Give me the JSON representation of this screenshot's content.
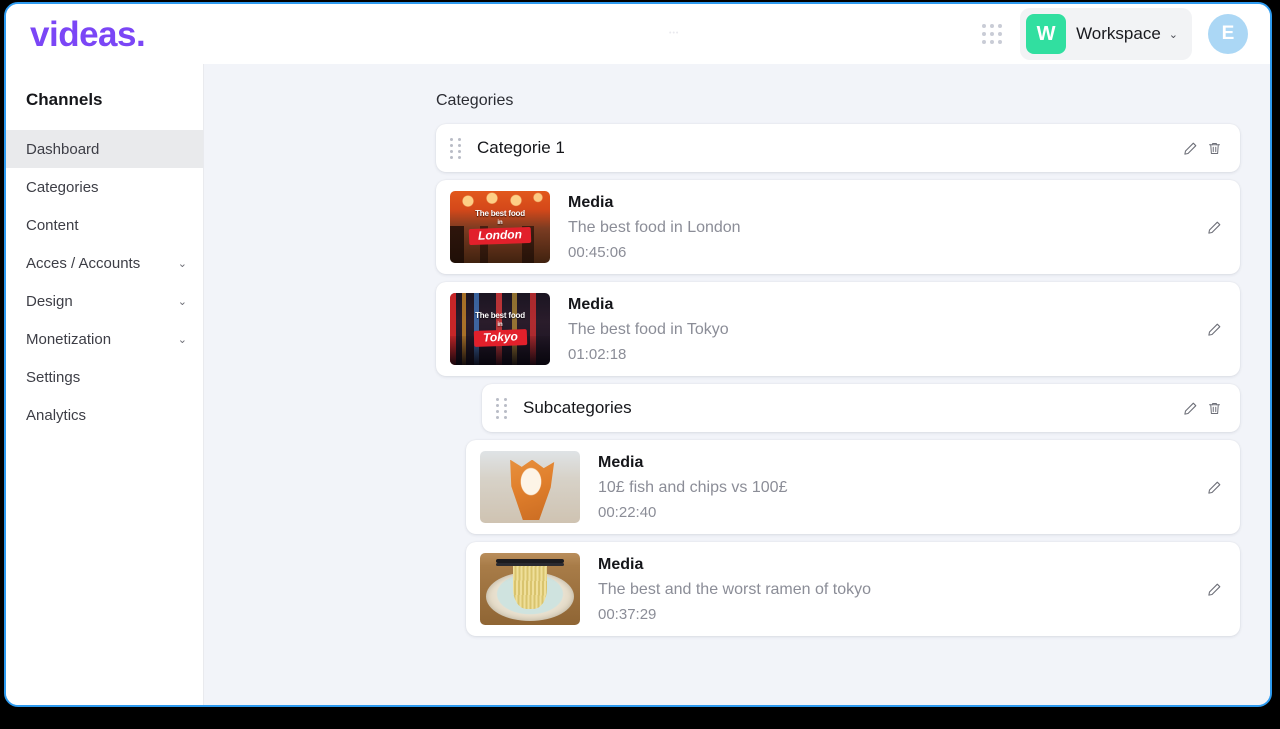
{
  "header": {
    "logo": "videas.",
    "apps_grid_icon": "grid-dots-icon",
    "workspace": {
      "badge_letter": "W",
      "name": "Workspace",
      "chevron": "⌄",
      "badge_color": "#31dfa0"
    },
    "avatar": {
      "letter": "E",
      "color": "#abd7f5"
    },
    "faint_mark": "•••"
  },
  "sidebar": {
    "title": "Channels",
    "items": [
      {
        "label": "Dashboard",
        "active": true,
        "expandable": false
      },
      {
        "label": "Categories",
        "active": false,
        "expandable": false
      },
      {
        "label": "Content",
        "active": false,
        "expandable": false
      },
      {
        "label": "Acces / Accounts",
        "active": false,
        "expandable": true
      },
      {
        "label": "Design",
        "active": false,
        "expandable": true
      },
      {
        "label": "Monetization",
        "active": false,
        "expandable": true
      },
      {
        "label": "Settings",
        "active": false,
        "expandable": false
      },
      {
        "label": "Analytics",
        "active": false,
        "expandable": false
      }
    ],
    "chevron": "⌄"
  },
  "main": {
    "page_title": "Categories",
    "category": {
      "label": "Categorie 1",
      "drag_handle_icon": "drag-handle-icon",
      "edit_icon": "pencil-icon",
      "delete_icon": "trash-icon"
    },
    "subcategory": {
      "label": "Subcategories",
      "drag_handle_icon": "drag-handle-icon",
      "edit_icon": "pencil-icon",
      "delete_icon": "trash-icon"
    },
    "media_items_top": [
      {
        "kind": "Media",
        "title": "The best food in London",
        "duration": "00:45:06",
        "edit_icon": "pencil-icon",
        "thumb": {
          "art": "london",
          "line1": "The best food",
          "line2": "in",
          "banner": "London"
        }
      },
      {
        "kind": "Media",
        "title": "The best food in Tokyo",
        "duration": "01:02:18",
        "edit_icon": "pencil-icon",
        "thumb": {
          "art": "tokyo",
          "line1": "The best food",
          "line2": "in",
          "banner": "Tokyo"
        }
      }
    ],
    "media_items_sub": [
      {
        "kind": "Media",
        "title": "10£ fish and chips vs 100£",
        "duration": "00:22:40",
        "edit_icon": "pencil-icon",
        "thumb": {
          "art": "chips"
        }
      },
      {
        "kind": "Media",
        "title": "The best and the worst ramen of tokyo",
        "duration": "00:37:29",
        "edit_icon": "pencil-icon",
        "thumb": {
          "art": "ramen"
        }
      }
    ]
  },
  "colors": {
    "brand": "#7b46f6",
    "accent_green": "#31dfa0",
    "window_border": "#2e9bf0",
    "main_bg": "#f2f4f9",
    "page_bg": "#000000"
  }
}
